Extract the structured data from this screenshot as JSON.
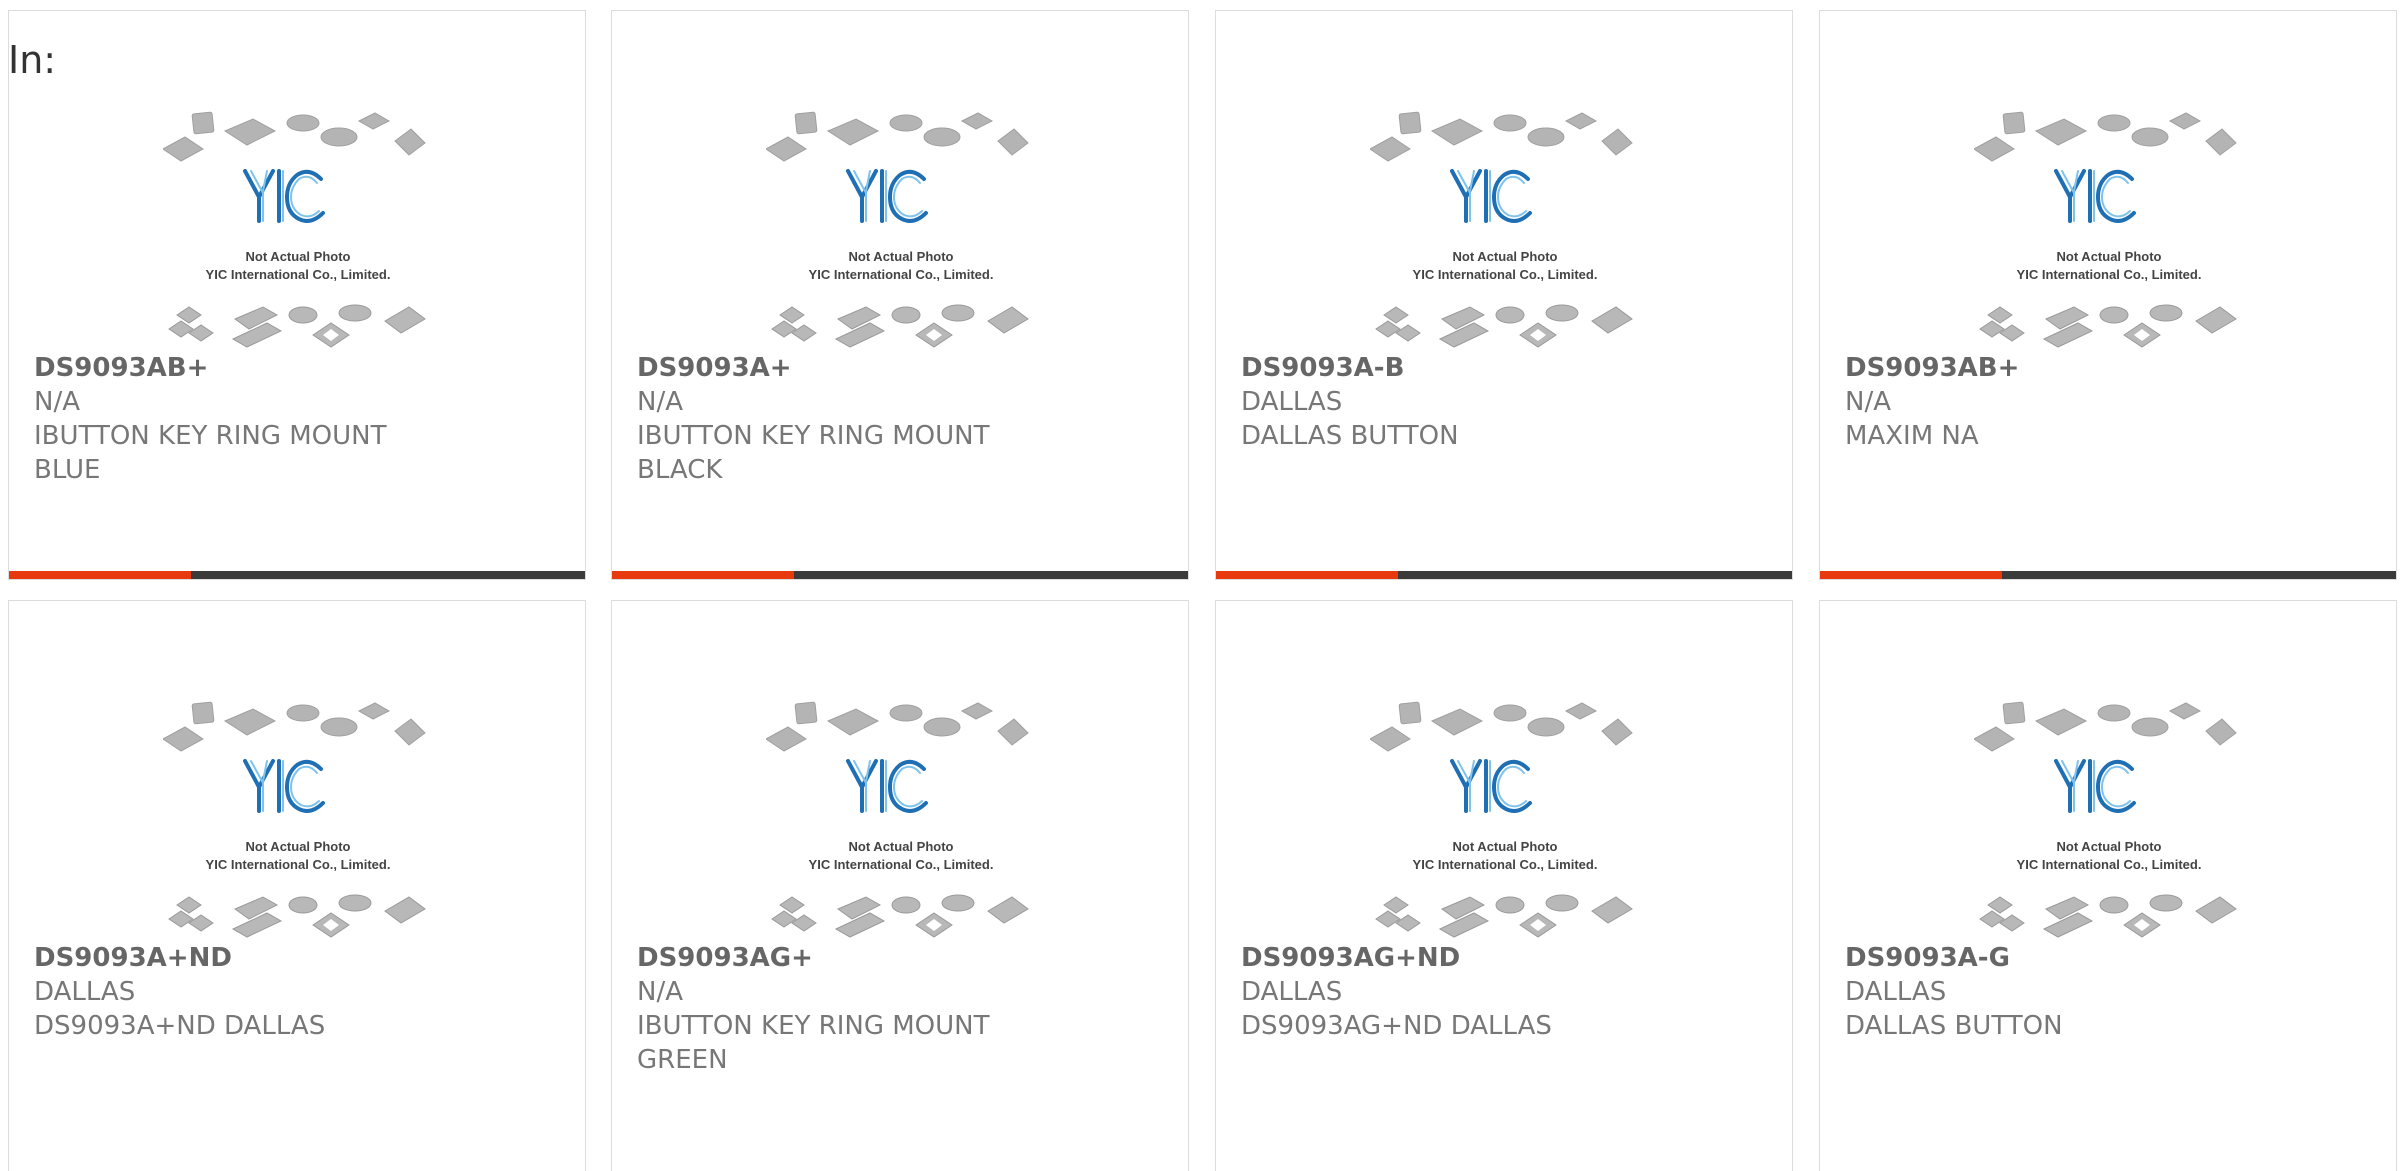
{
  "header": {
    "label": "In:"
  },
  "colors": {
    "accent": "#e8380d",
    "bar": "#3a3a3a"
  },
  "image": {
    "line1": "Not Actual Photo",
    "line2": "YIC International Co., Limited.",
    "logo": "YIC"
  },
  "cards": [
    {
      "part": "DS9093AB+",
      "maker": "N/A",
      "desc1": "IBUTTON KEY RING MOUNT",
      "desc2": "BLUE"
    },
    {
      "part": "DS9093A+",
      "maker": "N/A",
      "desc1": "IBUTTON KEY RING MOUNT",
      "desc2": "BLACK"
    },
    {
      "part": "DS9093A-B",
      "maker": "DALLAS",
      "desc1": "DALLAS BUTTON",
      "desc2": ""
    },
    {
      "part": "DS9093AB+",
      "maker": "N/A",
      "desc1": "MAXIM NA",
      "desc2": ""
    },
    {
      "part": "DS9093A+ND",
      "maker": "DALLAS",
      "desc1": "DS9093A+ND DALLAS",
      "desc2": ""
    },
    {
      "part": "DS9093AG+",
      "maker": "N/A",
      "desc1": "IBUTTON KEY RING MOUNT",
      "desc2": "GREEN"
    },
    {
      "part": "DS9093AG+ND",
      "maker": "DALLAS",
      "desc1": "DS9093AG+ND DALLAS",
      "desc2": ""
    },
    {
      "part": "DS9093A-G",
      "maker": "DALLAS",
      "desc1": "DALLAS BUTTON",
      "desc2": ""
    }
  ]
}
